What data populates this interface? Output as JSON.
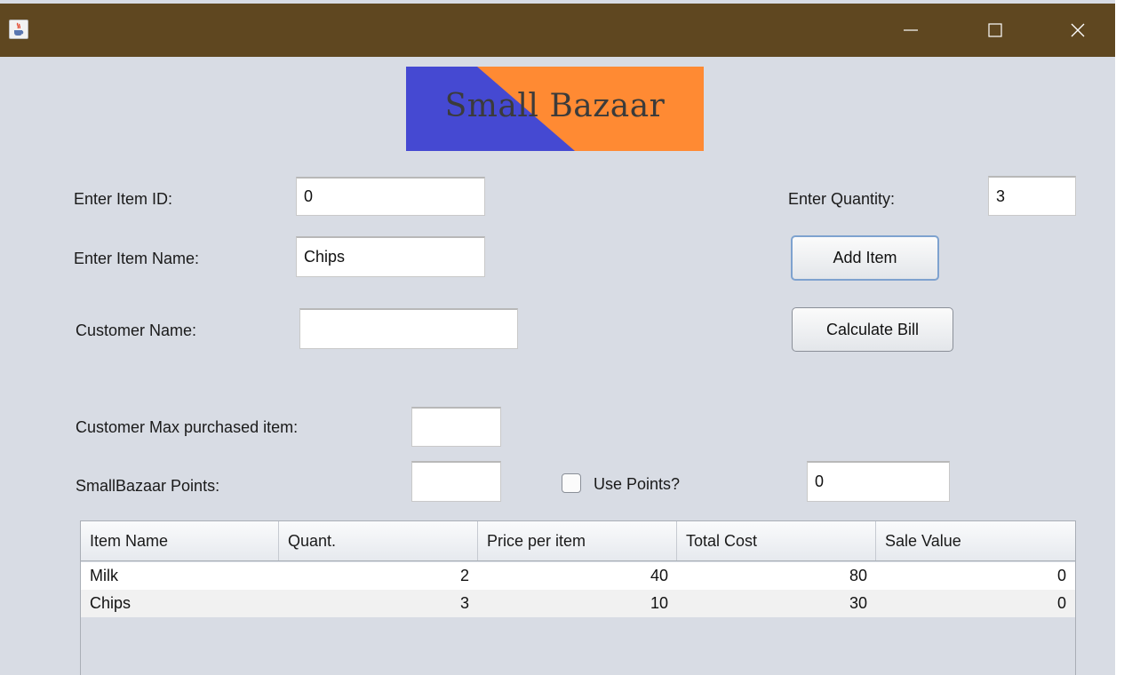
{
  "window": {
    "app_icon": "java-cup-icon",
    "controls": [
      "minimize-icon",
      "maximize-icon",
      "close-icon"
    ],
    "titlebar_color": "#5f4720"
  },
  "logo": {
    "text": "Small Bazaar",
    "colors": {
      "left": "#4549d2",
      "right": "#ff8a33"
    }
  },
  "form": {
    "item_id": {
      "label": "Enter Item ID:",
      "value": "0"
    },
    "item_name": {
      "label": "Enter Item Name:",
      "value": "Chips"
    },
    "customer_name": {
      "label": "Customer Name:",
      "value": ""
    },
    "max_item": {
      "label": "Customer Max purchased item:",
      "value": ""
    },
    "points": {
      "label": "SmallBazaar Points:",
      "value": ""
    },
    "quantity": {
      "label": "Enter Quantity:",
      "value": "3"
    },
    "use_points": {
      "label": "Use Points?",
      "checked": false
    },
    "points_value": {
      "value": "0"
    }
  },
  "buttons": {
    "add_item": "Add Item",
    "calculate_bill": "Calculate Bill"
  },
  "table": {
    "columns": [
      "Item Name",
      "Quant.",
      "Price per item",
      "Total Cost",
      "Sale Value"
    ],
    "rows": [
      [
        "Milk",
        "2",
        "40",
        "80",
        "0"
      ],
      [
        "Chips",
        "3",
        "10",
        "30",
        "0"
      ]
    ]
  }
}
